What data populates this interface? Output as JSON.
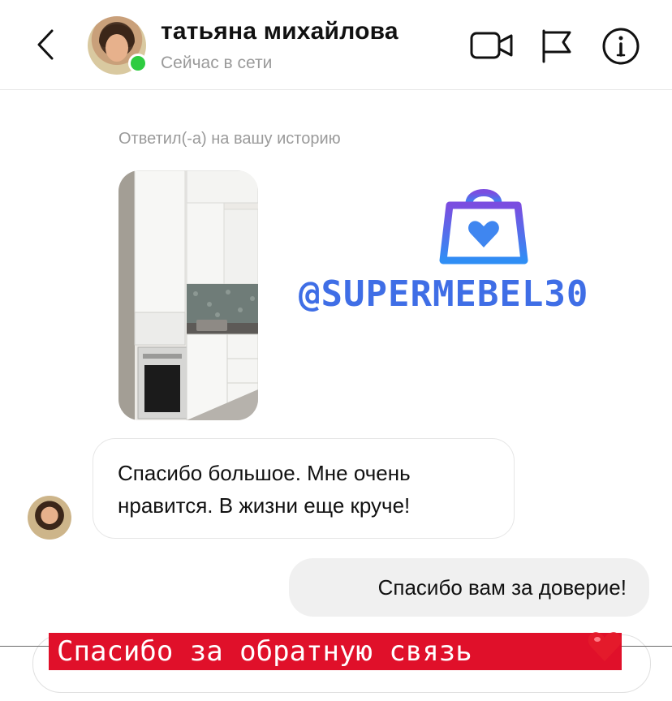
{
  "header": {
    "back_icon": "chevron-left-icon",
    "user_name": "татьяна михайлова",
    "status": "Сейчас в сети",
    "actions": [
      "video-call-icon",
      "flag-icon",
      "info-icon"
    ]
  },
  "chat": {
    "reply_note": "Ответил(-а) на вашу историю",
    "story_brand": "@SUPERMEBEL30",
    "incoming_message": "Спасибо большое. Мне очень нравится. В жизни еще круче!",
    "outgoing_message": "Спасибо вам за доверие!"
  },
  "caption": {
    "text": "Спасибо за обратную связь",
    "emoji": "❤️"
  },
  "colors": {
    "online": "#2ecc40",
    "brand_gradient_start": "#7b4de0",
    "brand_gradient_end": "#2f8ef5",
    "caption_bg": "#e0102a"
  }
}
